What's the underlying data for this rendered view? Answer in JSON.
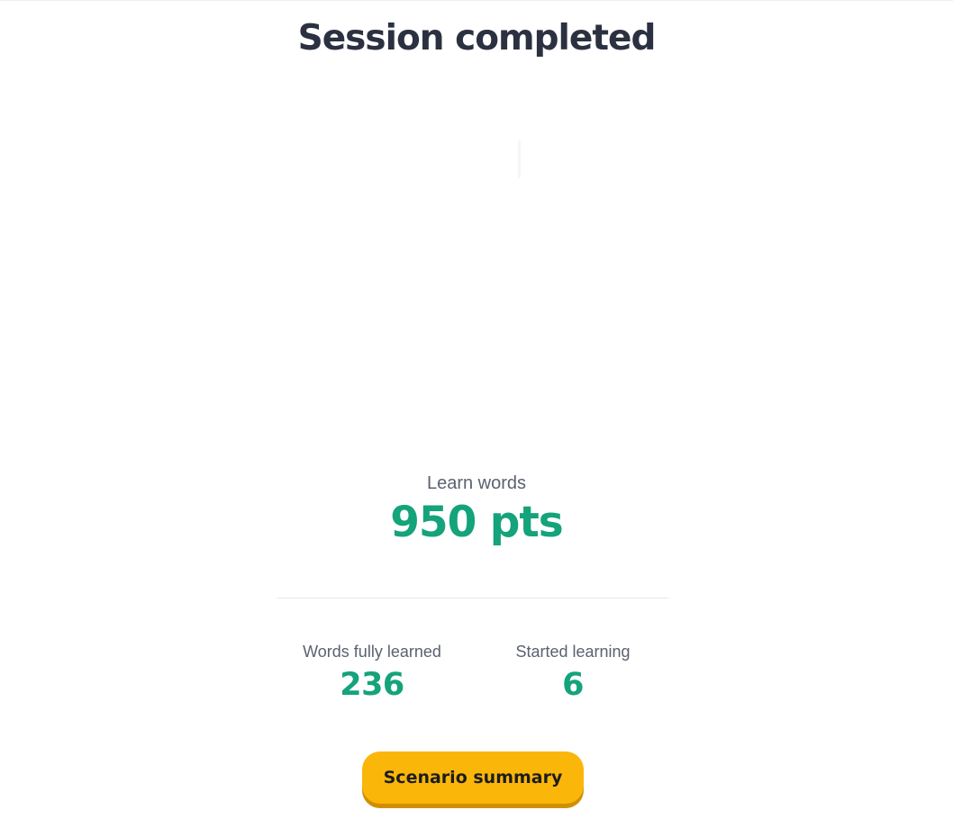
{
  "header": {
    "title": "Session completed"
  },
  "illustration": {
    "name": "celebration-illustration"
  },
  "score": {
    "activity": "Learn words",
    "points": "950 pts"
  },
  "stats": {
    "fully_learned": {
      "label": "Words fully learned",
      "value": "236"
    },
    "started": {
      "label": "Started learning",
      "value": "6"
    }
  },
  "actions": {
    "summary_label": "Scenario summary"
  },
  "colors": {
    "title": "#2b3140",
    "accent_green": "#14a37a",
    "button_yellow": "#fbb60a",
    "button_shadow": "#d08f00",
    "muted_text": "#5b6170"
  }
}
